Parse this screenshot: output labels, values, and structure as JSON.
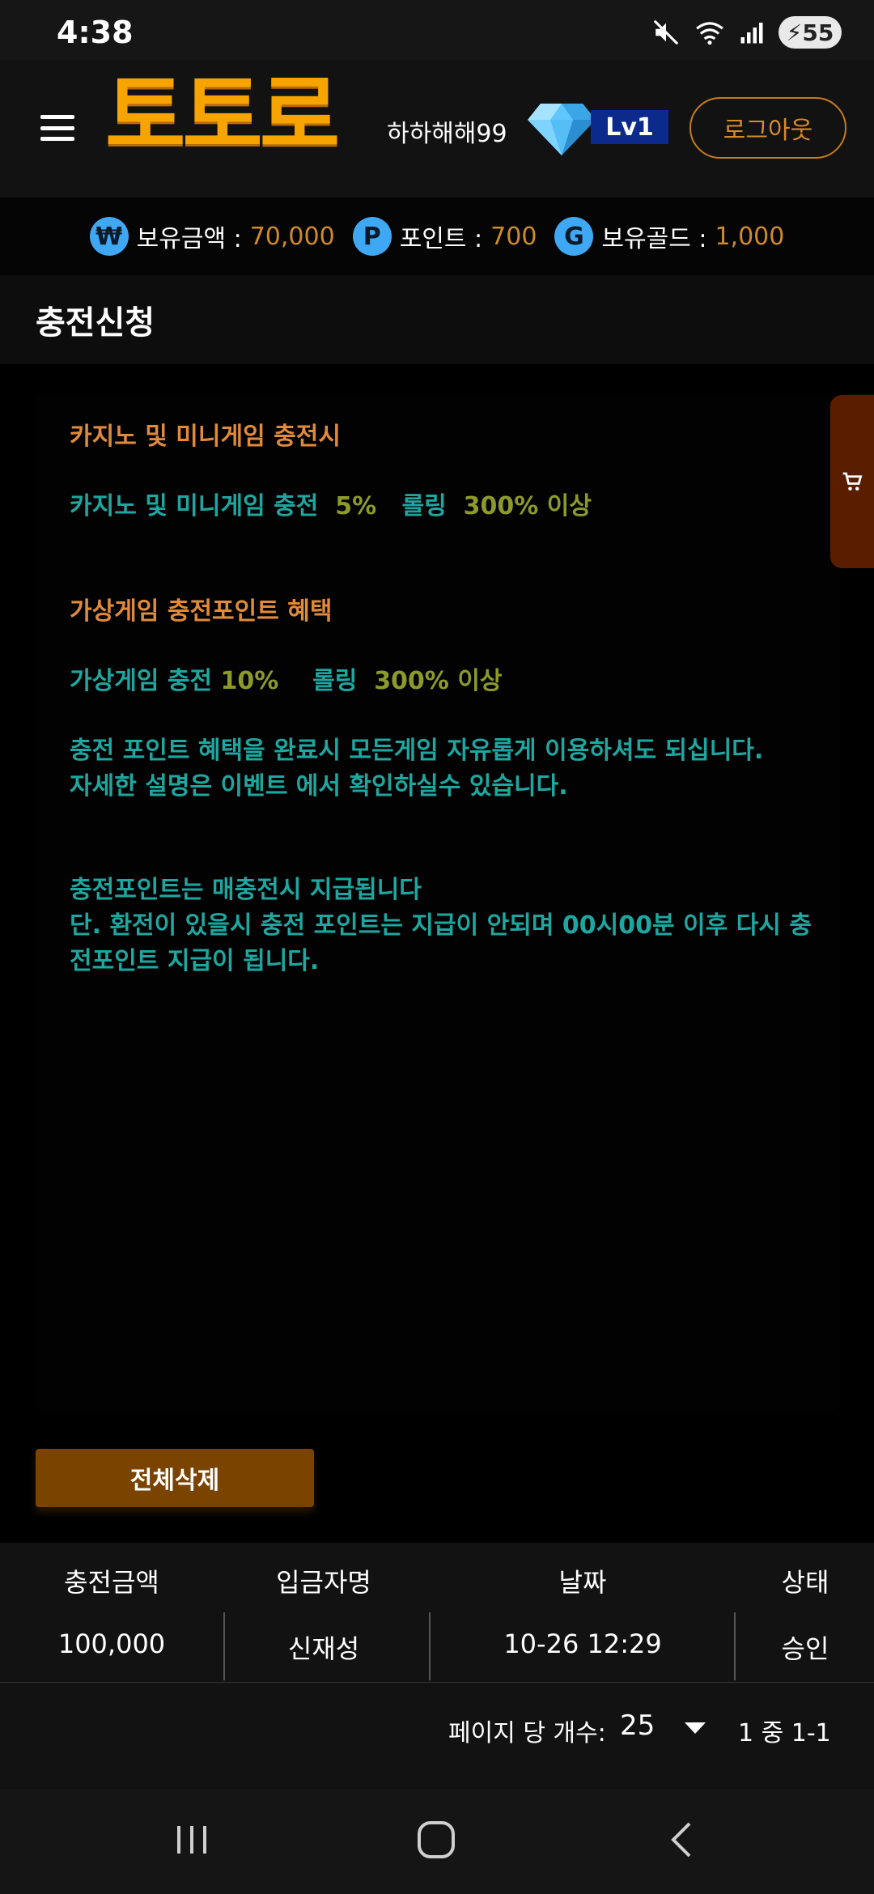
{
  "status_bar": {
    "time": "4:38",
    "battery": "55"
  },
  "header": {
    "logo_text": "토토로",
    "username": "하하해해99",
    "level": "Lv1",
    "logout_label": "로그아웃"
  },
  "balances": [
    {
      "icon": "₩",
      "label": "보유금액 :",
      "value": "70,000"
    },
    {
      "icon": "P",
      "label": "포인트 :",
      "value": "700"
    },
    {
      "icon": "G",
      "label": "보유골드 :",
      "value": "1,000"
    }
  ],
  "page_title": "충전신청",
  "notice": {
    "casino_title": "카지노 및 미니게임 충전시",
    "casino_line": {
      "prefix": "카지노 및 미니게임 충전",
      "bonus": "5%",
      "rolling_label": "롤링",
      "rolling": "300% 이상"
    },
    "virtual_title": "가상게임 충전포인트 혜택",
    "virtual_line": {
      "prefix": "가상게임 충전",
      "bonus": "10%",
      "rolling_label": "롤링",
      "rolling": "300% 이상"
    },
    "paragraph1": [
      "충전 포인트 혜택을 완료시 모든게임 자유롭게 이용하셔도 되십니다.",
      "자세한 설명은 이벤트 에서 확인하실수 있습니다."
    ],
    "paragraph2": [
      "충전포인트는 매충전시 지급됩니다",
      "단. 환전이 있을시 충전 포인트는 지급이 안되며 00시00분 이후 다시 충",
      "전포인트 지급이 됩니다."
    ]
  },
  "delete_all_label": "전체삭제",
  "table": {
    "headers": [
      "충전금액",
      "입금자명",
      "날짜",
      "상태"
    ],
    "rows": [
      [
        "100,000",
        "신재성",
        "10-26 12:29",
        "승인"
      ]
    ]
  },
  "pagination": {
    "per_page_label": "페이지 당 개수:",
    "per_page_value": "25",
    "range": "1 중 1-1"
  },
  "colors": {
    "accent_orange": "#f7a400",
    "teal": "#1ea7a0",
    "olive": "#8d9a2a",
    "coin_blue": "#3fa8f4"
  }
}
